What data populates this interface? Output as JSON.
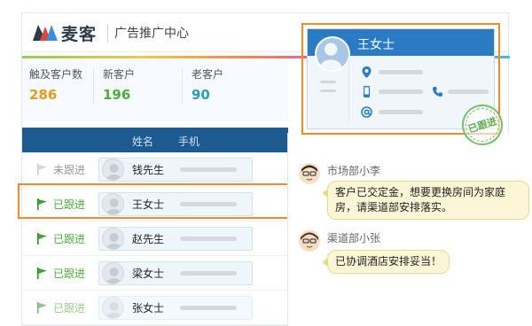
{
  "header": {
    "logo_text": "麦客",
    "subtitle": "广告推广中心",
    "logo_icon": "makemaker-m-logo-icon"
  },
  "stats": [
    {
      "label": "触及客户数",
      "value": "286",
      "color": "#e39a1c"
    },
    {
      "label": "新客户",
      "value": "196",
      "color": "#4caf3c"
    },
    {
      "label": "老客户",
      "value": "90",
      "color": "#2a9dbe"
    }
  ],
  "table": {
    "headers": {
      "name": "姓名",
      "phone": "手机"
    },
    "rows": [
      {
        "status": "未跟进",
        "name": "钱先生",
        "followed": false
      },
      {
        "status": "已跟进",
        "name": "王女士",
        "followed": true
      },
      {
        "status": "已跟进",
        "name": "赵先生",
        "followed": true
      },
      {
        "status": "已跟进",
        "name": "梁女士",
        "followed": true
      },
      {
        "status": "已跟进",
        "name": "张女士",
        "followed": true
      }
    ]
  },
  "card": {
    "name": "王女士",
    "icons": [
      "location-pin-icon",
      "mobile-phone-icon",
      "telephone-icon",
      "email-at-icon"
    ],
    "stamp": "已跟进"
  },
  "chat": [
    {
      "sender": "市场部小李",
      "message": "客户已交定金，想要更换房间为家庭房，请渠道部安排落实。"
    },
    {
      "sender": "渠道部小张",
      "message": "已协调酒店安排妥当！"
    }
  ],
  "colors": {
    "primary_blue": "#2b7bc4",
    "table_header": "#1d5a8f",
    "followed_green": "#4caf3c",
    "highlight_orange": "#f08a28",
    "bubble_yellow": "#fdf6d6"
  }
}
